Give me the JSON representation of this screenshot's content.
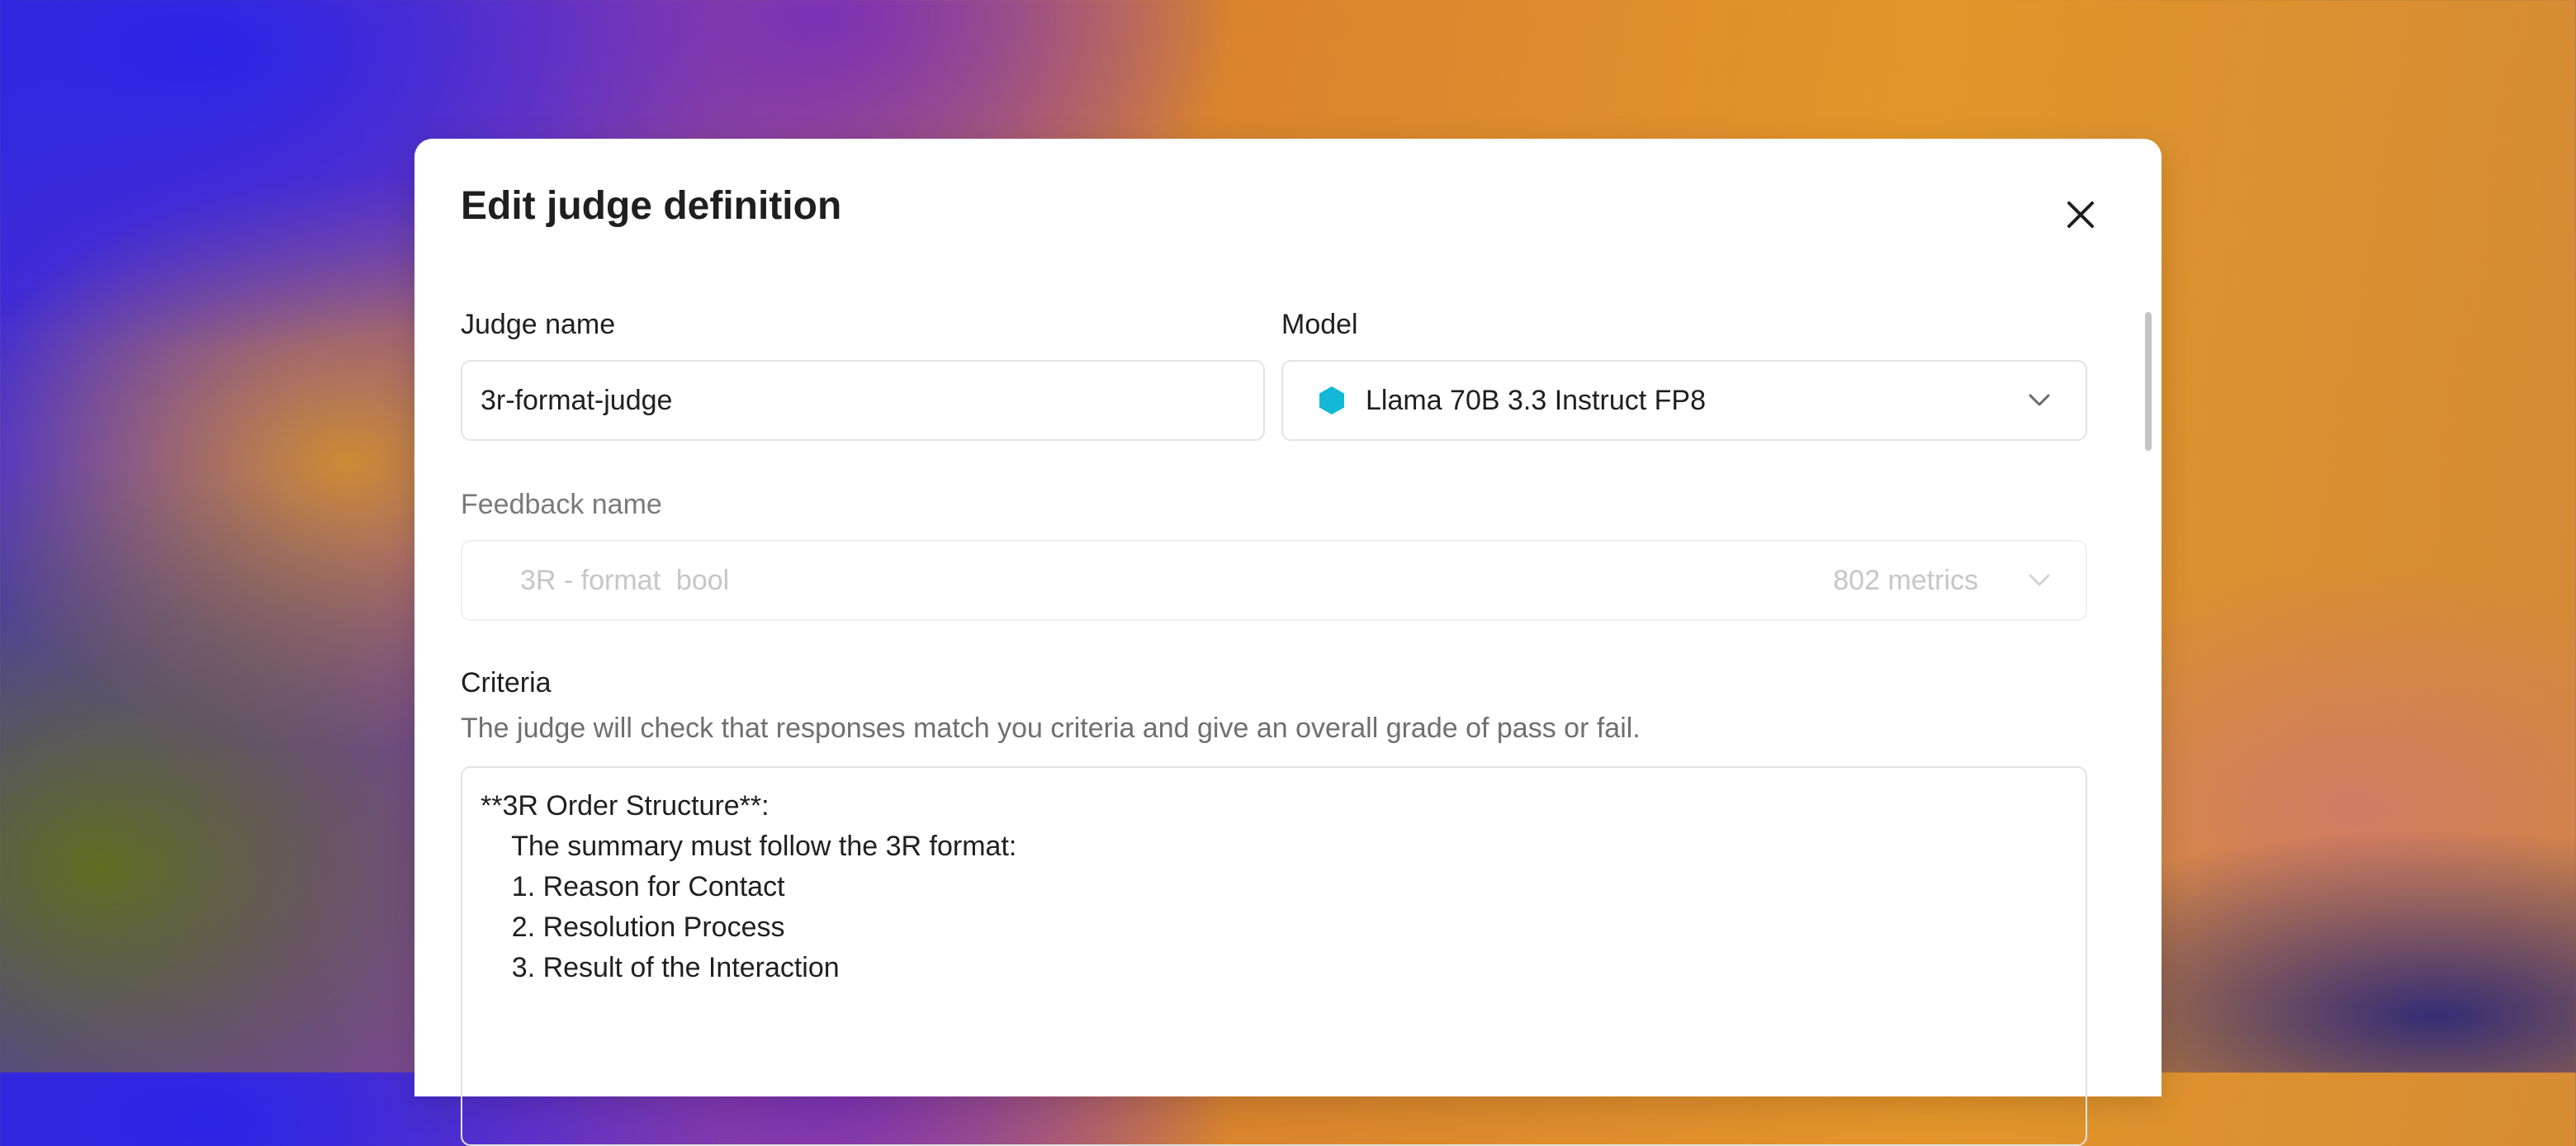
{
  "dialog": {
    "title": "Edit judge definition",
    "close_icon": "close-icon"
  },
  "judge_name": {
    "label": "Judge name",
    "value": "3r-format-judge"
  },
  "model": {
    "label": "Model",
    "icon": "hexagon-icon",
    "icon_color": "#12b8d6",
    "selected": "Llama 70B 3.3 Instruct FP8"
  },
  "feedback": {
    "label": "Feedback name",
    "value": "3R - format  bool",
    "count": "802 metrics"
  },
  "criteria": {
    "label": "Criteria",
    "description": "The judge will check that responses match you criteria and give an overall grade of pass or fail.",
    "lines": [
      "**3R Order Structure**:",
      "    The summary must follow the 3R format:",
      "    1. Reason for Contact",
      "    2. Resolution Process",
      "    3. Result of the Interaction"
    ]
  }
}
